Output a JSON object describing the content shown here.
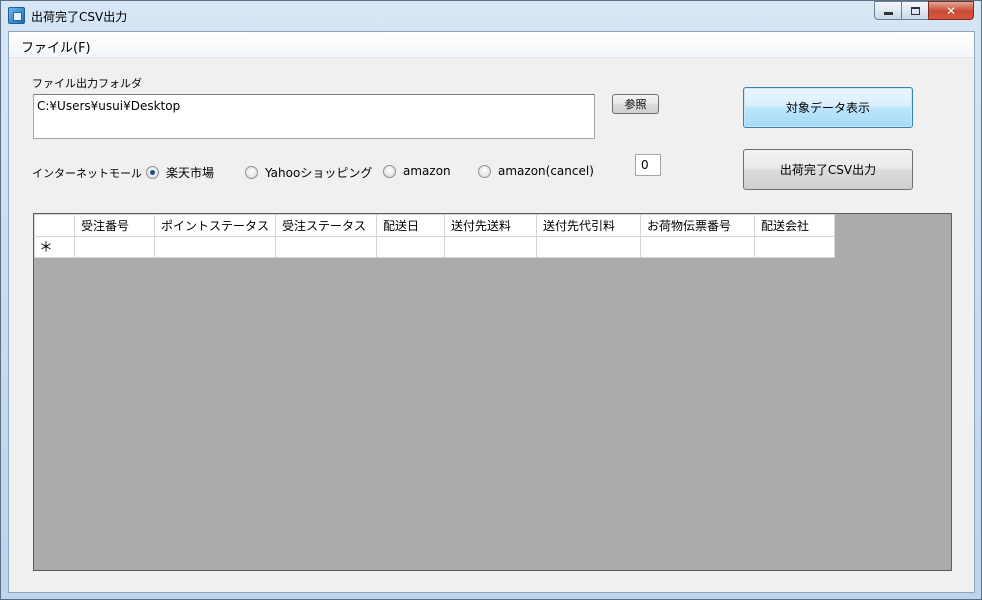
{
  "window": {
    "title": "出荷完了CSV出力",
    "controls": {
      "minimize": "",
      "maximize": "",
      "close": "✕"
    }
  },
  "menu": {
    "file": "ファイル(F)"
  },
  "folder": {
    "label": "ファイル出力フォルダ",
    "value": "C:¥Users¥usui¥Desktop",
    "browse_button": "参照"
  },
  "mall": {
    "label": "インターネットモール",
    "options": [
      {
        "label": "楽天市場",
        "checked": true
      },
      {
        "label": "Yahooショッピング",
        "checked": false
      },
      {
        "label": "amazon",
        "checked": false
      },
      {
        "label": "amazon(cancel)",
        "checked": false
      }
    ]
  },
  "count_value": "0",
  "buttons": {
    "show_data": "対象データ表示",
    "export_csv": "出荷完了CSV出力"
  },
  "grid": {
    "columns": [
      "受注番号",
      "ポイントステータス",
      "受注ステータス",
      "配送日",
      "送付先送料",
      "送付先代引料",
      "お荷物伝票番号",
      "配送会社"
    ],
    "new_row_marker": "＊"
  }
}
